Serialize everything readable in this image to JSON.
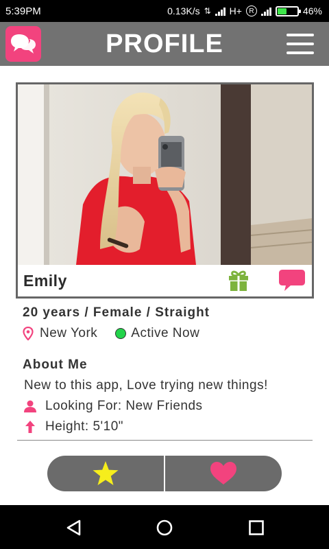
{
  "status_bar": {
    "time": "5:39PM",
    "network_speed": "0.13K/s",
    "network_type": "H+",
    "roaming": "R",
    "battery_percent": "46%",
    "battery_level": 0.46
  },
  "header": {
    "title": "PROFILE",
    "logo_icon": "chat-bubbles-icon",
    "menu_icon": "hamburger-menu-icon"
  },
  "profile": {
    "name": "Emily",
    "stats": "20 years / Female / Straight",
    "location": "New York",
    "activity_status": "Active Now",
    "about_title": "About Me",
    "about_text": "New to this app, Love trying new things!",
    "looking_for": "Looking For: New Friends",
    "height": "Height: 5'10\""
  },
  "actions": {
    "favorite_icon": "star-icon",
    "like_icon": "heart-icon",
    "gift_icon": "gift-icon",
    "message_icon": "speech-bubble-icon"
  },
  "colors": {
    "accent_pink": "#f2437e",
    "header_gray": "#727272",
    "gift_green": "#7db33d",
    "star_yellow": "#f6ee1c",
    "active_green": "#22d34a"
  },
  "nav": {
    "back_icon": "back-triangle-icon",
    "home_icon": "home-circle-icon",
    "recents_icon": "recents-square-icon"
  }
}
